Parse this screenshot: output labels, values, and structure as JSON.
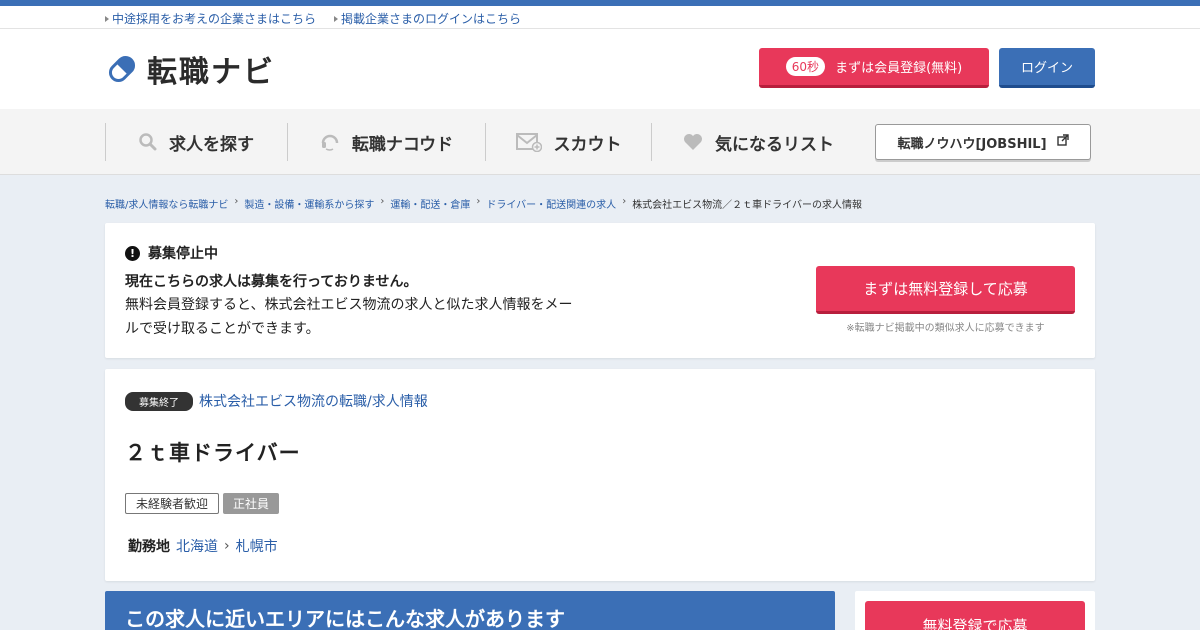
{
  "utility": {
    "links": [
      "中途採用をお考えの企業さまはこちら",
      "掲載企業さまのログインはこちら"
    ]
  },
  "header": {
    "logo_text": "転職ナビ",
    "register_pill": "60秒",
    "register_label": "まずは会員登録(無料)",
    "login_label": "ログイン"
  },
  "gnav": {
    "items": [
      {
        "label": "求人を探す",
        "icon": "search-icon"
      },
      {
        "label": "転職ナコウド",
        "icon": "headset-icon"
      },
      {
        "label": "スカウト",
        "icon": "mail-icon"
      },
      {
        "label": "気になるリスト",
        "icon": "heart-icon"
      }
    ],
    "jobshil_label": "転職ノウハウ[JOBSHIL]"
  },
  "breadcrumb": {
    "items": [
      "転職/求人情報なら転職ナビ",
      "製造・設備・運輸系から探す",
      "運輸・配送・倉庫",
      "ドライバー・配送関連の求人"
    ],
    "current": "株式会社エビス物流／２ｔ車ドライバーの求人情報"
  },
  "notice": {
    "heading": "募集停止中",
    "line1": "現在こちらの求人は募集を行っておりません。",
    "desc": "無料会員登録すると、株式会社エビス物流の求人と似た求人情報をメールで受け取ることができます。",
    "apply_label": "まずは無料登録して応募",
    "apply_note": "※転職ナビ掲載中の類似求人に応募できます"
  },
  "job": {
    "status_badge": "募集終了",
    "company_link": "株式会社エビス物流の転職/求人情報",
    "title": "２ｔ車ドライバー",
    "tags": [
      "未経験者歓迎",
      "正社員"
    ],
    "location_label": "勤務地",
    "prefecture": "北海道",
    "city": "札幌市"
  },
  "bottom": {
    "near_heading": "この求人に近いエリアにはこんな求人があります",
    "side_button": "無料登録で応募"
  },
  "colors": {
    "accent_blue": "#3b6fb6",
    "accent_red": "#e8385a",
    "link_blue": "#2a5ea8"
  }
}
